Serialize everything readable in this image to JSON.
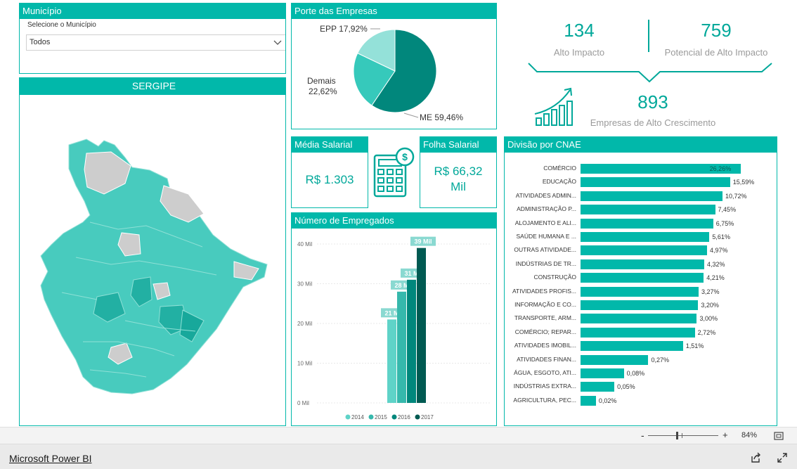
{
  "municipio": {
    "title": "Município",
    "select_label": "Selecione o Município",
    "selected": "Todos"
  },
  "map": {
    "title": "SERGIPE"
  },
  "porte": {
    "title": "Porte das Empresas",
    "slices": [
      {
        "label": "ME 59,46%",
        "value": 59.46,
        "color": "#01877c"
      },
      {
        "label": "Demais 22,62%",
        "value": 22.62,
        "color": "#36c9bb"
      },
      {
        "label": "EPP 17,92%",
        "value": 17.92,
        "color": "#94e1d9"
      }
    ],
    "label_epp": "EPP 17,92%",
    "label_demais_1": "Demais",
    "label_demais_2": "22,62%",
    "label_me": "ME 59,46%"
  },
  "kpis": {
    "alto_impacto_value": "134",
    "alto_impacto_label": "Alto Impacto",
    "potencial_value": "759",
    "potencial_label": "Potencial de Alto Impacto",
    "crescimento_value": "893",
    "crescimento_label": "Empresas de Alto Crescimento"
  },
  "media_salarial": {
    "title": "Média Salarial",
    "value": "R$ 1.303"
  },
  "folha_salarial": {
    "title": "Folha Salarial",
    "value_1": "R$ 66,32",
    "value_2": "Mil"
  },
  "empregados": {
    "title": "Número de Empregados",
    "legend": [
      "2014",
      "2015",
      "2016",
      "2017"
    ]
  },
  "cnae": {
    "title": "Divisão por CNAE"
  },
  "footer": {
    "zoom_minus": "-",
    "zoom_plus": "+",
    "zoom_level": "84%",
    "brand": "Microsoft Power BI"
  },
  "colors": {
    "accent": "#01b8aa",
    "dark": "#01877c",
    "darker": "#005a52"
  },
  "chart_data": [
    {
      "type": "pie",
      "title": "Porte das Empresas",
      "categories": [
        "ME",
        "Demais",
        "EPP"
      ],
      "values": [
        59.46,
        22.62,
        17.92
      ]
    },
    {
      "type": "bar",
      "title": "Número de Empregados",
      "categories": [
        "2014",
        "2015",
        "2016",
        "2017"
      ],
      "values": [
        21,
        28,
        31,
        39
      ],
      "data_labels": [
        "21 Mil",
        "28 Mil",
        "31 Mil",
        "39 Mil"
      ],
      "ylim": [
        0,
        40
      ],
      "yticks": [
        "0 Mil",
        "10 Mil",
        "20 Mil",
        "30 Mil",
        "40 Mil"
      ],
      "colors": [
        "#5fd3c8",
        "#36b8ac",
        "#01877c",
        "#005a52"
      ]
    },
    {
      "type": "bar",
      "title": "Divisão por CNAE",
      "orientation": "horizontal",
      "scale": "log",
      "xticks": [
        "0.1%",
        "1.0%",
        "10.0%",
        "100.0%"
      ],
      "categories": [
        "COMÉRCIO",
        "EDUCAÇÃO",
        "ATIVIDADES ADMIN...",
        "ADMINISTRAÇÃO P...",
        "ALOJAMENTO E ALI...",
        "SAÚDE HUMANA E ...",
        "OUTRAS ATIVIDADE...",
        "INDÚSTRIAS DE TR...",
        "CONSTRUÇÃO",
        "ATIVIDADES PROFIS...",
        "INFORMAÇÃO E CO...",
        "TRANSPORTE, ARM...",
        "COMÉRCIO; REPAR...",
        "ATIVIDADES IMOBIL...",
        "ATIVIDADES FINAN...",
        "ÁGUA, ESGOTO, ATI...",
        "INDÚSTRIAS EXTRA...",
        "AGRICULTURA, PEC..."
      ],
      "values": [
        26.26,
        15.59,
        10.72,
        7.45,
        6.75,
        5.61,
        4.97,
        4.32,
        4.21,
        3.27,
        3.2,
        3.0,
        2.72,
        1.51,
        0.27,
        0.08,
        0.05,
        0.02
      ],
      "data_labels": [
        "26,26%",
        "15,59%",
        "10,72%",
        "7,45%",
        "6,75%",
        "5,61%",
        "4,97%",
        "4,32%",
        "4,21%",
        "3,27%",
        "3,20%",
        "3,00%",
        "2,72%",
        "1,51%",
        "0,27%",
        "0,08%",
        "0,05%",
        "0,02%"
      ]
    }
  ]
}
